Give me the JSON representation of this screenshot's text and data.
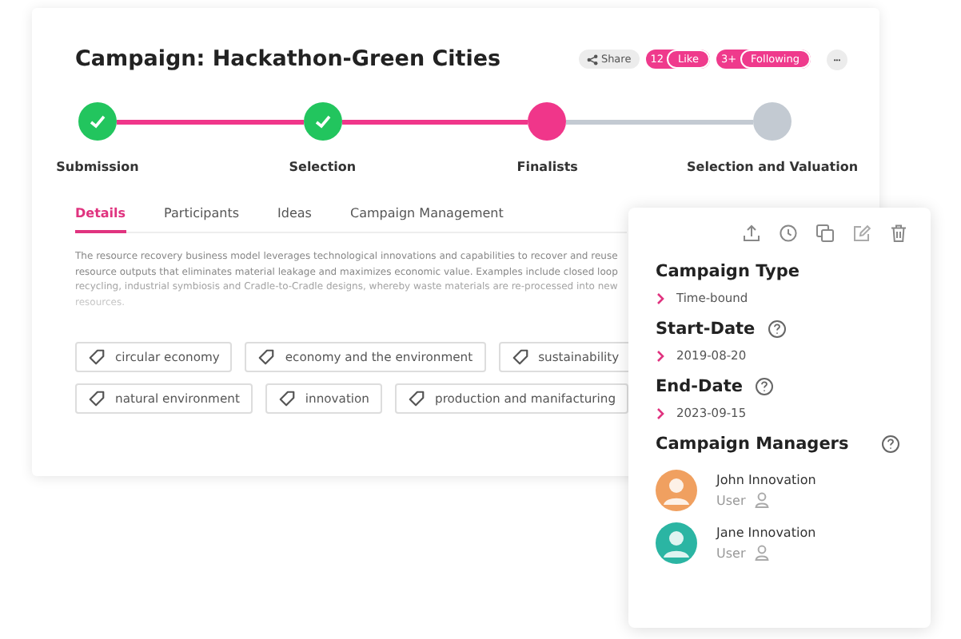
{
  "title": "Campaign: Hackathon-Green Cities",
  "actions": [
    {
      "kind": "plain",
      "label": "Share"
    },
    {
      "kind": "count",
      "count": "12",
      "label": "Like"
    },
    {
      "kind": "count",
      "count": "3+",
      "label": "Following"
    },
    {
      "kind": "more",
      "label": "•••"
    }
  ],
  "steps": [
    {
      "label": "Submission",
      "kind": "done"
    },
    {
      "label": "Selection",
      "kind": "done"
    },
    {
      "label": "Finalists",
      "kind": "current"
    },
    {
      "label": "Selection and Valuation",
      "kind": "pending"
    }
  ],
  "tabs": [
    {
      "label": "Details",
      "selected": true
    },
    {
      "label": "Participants",
      "selected": false
    },
    {
      "label": "Ideas",
      "selected": false
    },
    {
      "label": "Campaign Management",
      "selected": false
    }
  ],
  "description": "The resource recovery business model leverages technological innovations and capabilities to recover and reuse resource outputs that eliminates material leakage and maximizes economic value. Examples include closed loop recycling, industrial symbiosis and Cradle-to-Cradle designs, whereby waste materials are re-processed into new resources.",
  "tags": [
    [
      "circular economy",
      "economy and the environment",
      "sustainability"
    ],
    [
      "natural environment",
      "innovation",
      "production and manifacturing"
    ]
  ],
  "details": [
    {
      "heading": "Campaign Type",
      "help": false,
      "value": "Time-bound"
    },
    {
      "heading": "Start-Date",
      "help": true,
      "value": "2019-08-20"
    },
    {
      "heading": "End-Date",
      "help": true,
      "value": "2023-09-15"
    }
  ],
  "managers": {
    "heading": "Campaign Managers",
    "help": true,
    "people": [
      {
        "name": "John Innovation",
        "role": "User",
        "color": "#f0a060"
      },
      {
        "name": "Jane Innovation",
        "role": "User",
        "color": "#2bb5a3"
      }
    ]
  }
}
